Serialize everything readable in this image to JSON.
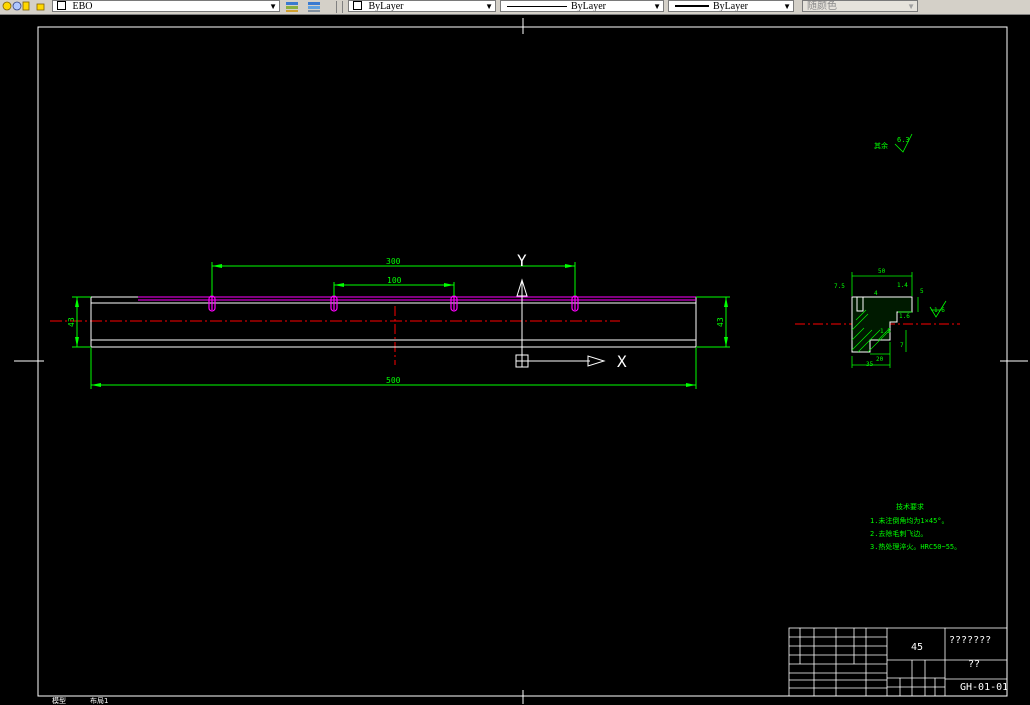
{
  "toolbar": {
    "layer_name": "EBO",
    "color_value": "ByLayer",
    "linetype_value": "ByLayer",
    "lineweight_value": "ByLayer",
    "plotstyle_value": "随颜色"
  },
  "drawing": {
    "dims": {
      "top_length": "300",
      "inner_length": "100",
      "total_length": "500",
      "left_height": "43",
      "right_height": "43",
      "sec_width": "50",
      "sec_d1": "7.5",
      "sec_d2": "4",
      "sec_d3": "1.4",
      "sec_d4": "5",
      "sec_d5": "1.6",
      "sec_d6": "1.5",
      "sec_d7": "1.6",
      "sec_d8": "7",
      "sec_d9": "20",
      "sec_d10": "35"
    },
    "ucs": {
      "x_label": "X",
      "y_label": "Y"
    },
    "roughness": {
      "label": "其余",
      "value": "6.3"
    },
    "notes": {
      "title": "技术要求",
      "items": [
        "1.未注倒角均为1×45°。",
        "2.去除毛刺飞边。",
        "3.热处理淬火。HRC50~55。"
      ]
    },
    "title_block": {
      "material": "45",
      "part_name": "???????",
      "company": "??",
      "drawing_no": "GH-01-01"
    }
  },
  "tabs": {
    "model": "模型",
    "layout": "布局1"
  },
  "colors": {
    "background": "#000000",
    "geometry": "#ffffff",
    "dimension": "#00ff00",
    "centerline": "#ff0000",
    "hole": "#ff00ff",
    "toolbar": "#d4d0c8"
  }
}
